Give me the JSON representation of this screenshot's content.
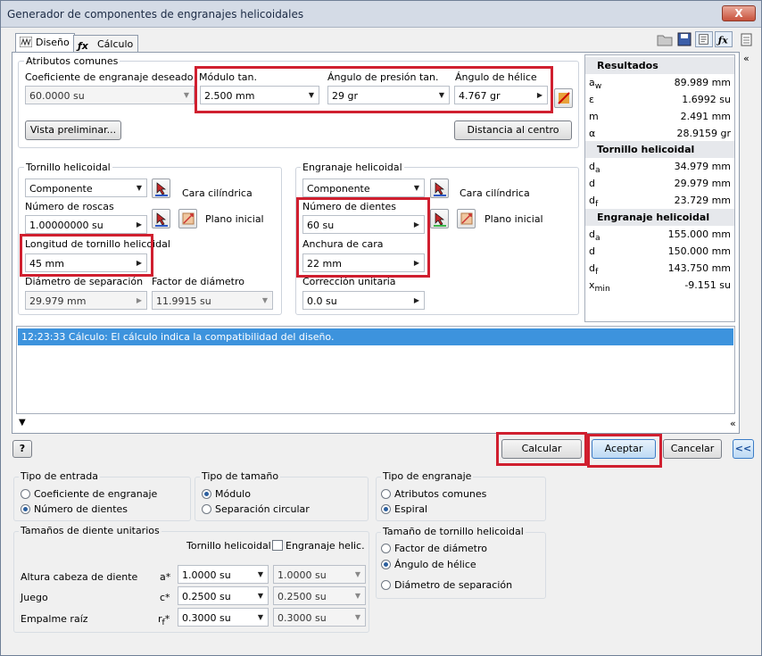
{
  "window": {
    "title": "Generador de componentes de engranajes helicoidales",
    "close": "X"
  },
  "tabs": [
    {
      "label": "Diseño"
    },
    {
      "label": "Cálculo"
    }
  ],
  "common": {
    "group_title": "Atributos comunes",
    "coef_label": "Coeficiente de engranaje deseado",
    "coef_value": "60.0000 su",
    "module_label": "Módulo tan.",
    "module_value": "2.500 mm",
    "pressure_label": "Ángulo de presión tan.",
    "pressure_value": "29 gr",
    "helix_label": "Ángulo de hélice",
    "helix_value": "4.767 gr",
    "preview_button": "Vista preliminar...",
    "center_button": "Distancia al centro"
  },
  "worm": {
    "group_title": "Tornillo helicoidal",
    "component_value": "Componente",
    "cyl_face": "Cara cilíndrica",
    "threads_label": "Número de roscas",
    "threads_value": "1.00000000 su",
    "start_plane": "Plano inicial",
    "length_label": "Longitud de tornillo helicoidal",
    "length_value": "45 mm",
    "pitch_diam_label": "Diámetro de separación",
    "pitch_diam_value": "29.979 mm",
    "diam_factor_label": "Factor de diámetro",
    "diam_factor_value": "11.9915 su"
  },
  "gear": {
    "group_title": "Engranaje helicoidal",
    "component_value": "Componente",
    "cyl_face": "Cara cilíndrica",
    "teeth_label": "Número de dientes",
    "teeth_value": "60 su",
    "start_plane": "Plano inicial",
    "face_width_label": "Anchura de cara",
    "face_width_value": "22 mm",
    "unit_corr_label": "Corrección unitaria",
    "unit_corr_value": "0.0 su"
  },
  "results": {
    "title": "Resultados",
    "rows": [
      {
        "sym": "aw",
        "value": "89.989 mm"
      },
      {
        "sym": "ε",
        "value": "1.6992 su"
      },
      {
        "sym": "m",
        "value": "2.491 mm"
      },
      {
        "sym": "α",
        "value": "28.9159 gr"
      }
    ],
    "worm_title": "Tornillo helicoidal",
    "worm_rows": [
      {
        "sym": "da",
        "value": "34.979 mm"
      },
      {
        "sym": "d",
        "value": "29.979 mm"
      },
      {
        "sym": "df",
        "value": "23.729 mm"
      }
    ],
    "gear_title": "Engranaje helicoidal",
    "gear_rows": [
      {
        "sym": "da",
        "value": "155.000 mm"
      },
      {
        "sym": "d",
        "value": "150.000 mm"
      },
      {
        "sym": "df",
        "value": "143.750 mm"
      },
      {
        "sym": "xmin",
        "value": "-9.151 su"
      }
    ]
  },
  "message": "12:23:33 Cálculo: El cálculo indica la compatibilidad del diseño.",
  "buttons": {
    "help": "?",
    "calculate": "Calcular",
    "accept": "Aceptar",
    "cancel": "Cancelar",
    "collapse": "<<"
  },
  "input_type": {
    "title": "Tipo de entrada",
    "opt1": "Coeficiente de engranaje",
    "opt2": "Número de dientes",
    "selected": 2
  },
  "size_type": {
    "title": "Tipo de tamaño",
    "opt1": "Módulo",
    "opt2": "Separación circular",
    "selected": 1
  },
  "gear_type": {
    "title": "Tipo de engranaje",
    "opt1": "Atributos comunes",
    "opt2": "Espiral",
    "selected": 2
  },
  "tooth_sizes": {
    "title": "Tamaños de diente unitarios",
    "col_worm": "Tornillo helicoidal",
    "col_gear": "Engranaje helic.",
    "rows": [
      {
        "label": "Altura cabeza de diente",
        "sym": "a*",
        "worm": "1.0000 su",
        "gear": "1.0000 su"
      },
      {
        "label": "Juego",
        "sym": "c*",
        "worm": "0.2500 su",
        "gear": "0.2500 su"
      },
      {
        "label": "Empalme raíz",
        "sym": "rf*",
        "worm": "0.3000 su",
        "gear": "0.3000 su"
      }
    ]
  },
  "worm_size": {
    "title": "Tamaño de tornillo helicoidal",
    "opt1": "Factor de diámetro",
    "opt2": "Ángulo de hélice",
    "opt3": "Diámetro de separación",
    "selected": 2
  },
  "colors": {
    "highlight": "#d01f2f",
    "selection": "#3d93dd"
  }
}
